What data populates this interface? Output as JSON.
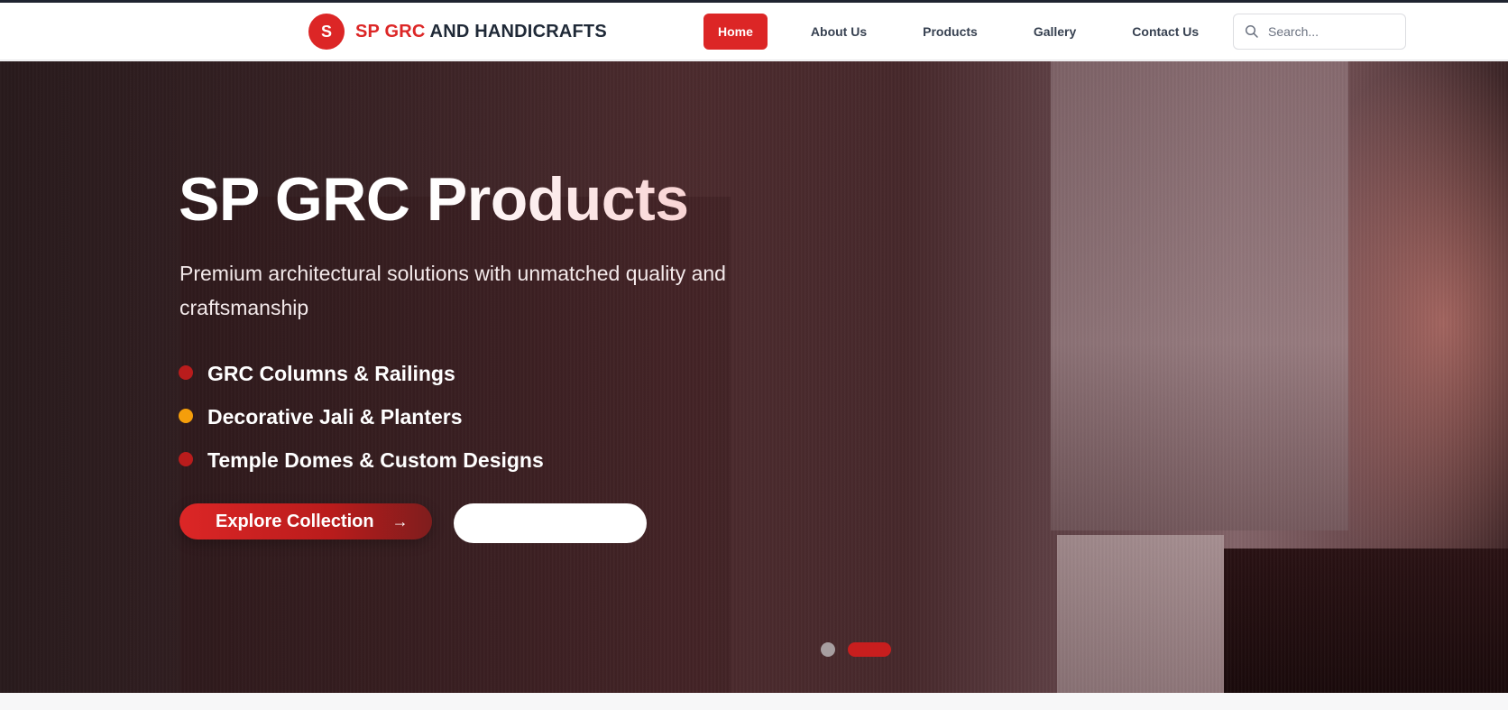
{
  "brand": {
    "badge_letter": "S",
    "name_highlight": "SP GRC",
    "name_rest": "AND HANDICRAFTS",
    "accent_color": "#dc2626"
  },
  "nav": {
    "items": [
      {
        "label": "Home",
        "active": true
      },
      {
        "label": "About Us",
        "active": false
      },
      {
        "label": "Products",
        "active": false
      },
      {
        "label": "Gallery",
        "active": false
      },
      {
        "label": "Contact Us",
        "active": false
      }
    ]
  },
  "search": {
    "placeholder": "Search...",
    "value": "",
    "icon": "search-icon"
  },
  "hero": {
    "title": "SP GRC Products",
    "subtitle": "Premium architectural solutions with unmatched quality and craftsmanship",
    "features": [
      {
        "label": "GRC Columns & Railings",
        "dot_color": "#b91c1c"
      },
      {
        "label": "Decorative Jali & Planters",
        "dot_color": "#f59e0b"
      },
      {
        "label": "Temple Domes & Custom Designs",
        "dot_color": "#b91c1c"
      }
    ],
    "primary_button": {
      "label": "Explore Collection",
      "icon": "arrow-right-icon"
    },
    "secondary_button": {
      "label": ""
    },
    "slides": {
      "total": 2,
      "active_index": 1
    }
  }
}
